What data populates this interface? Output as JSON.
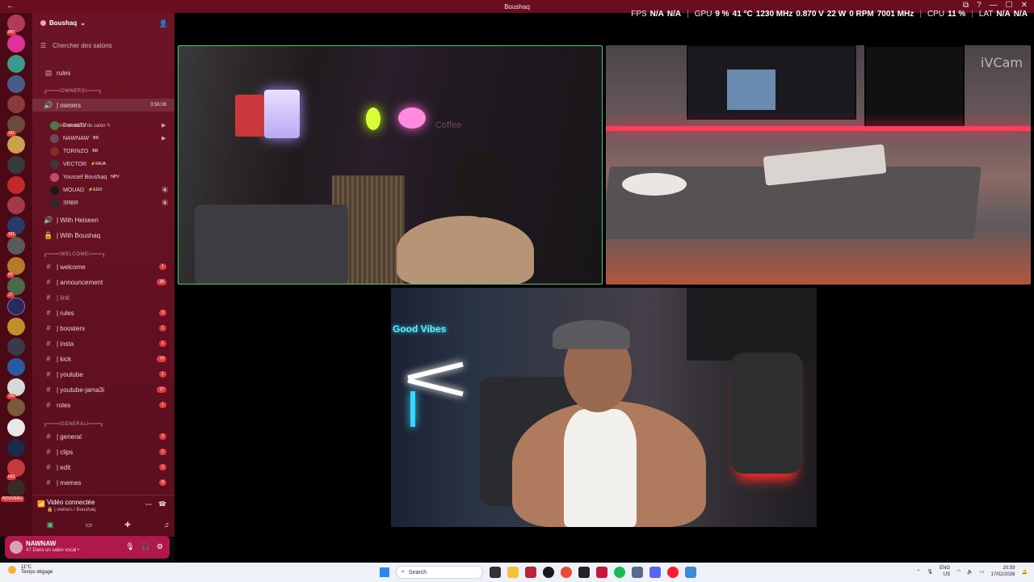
{
  "window": {
    "title": "Boushaq",
    "back": "←",
    "controls": [
      "⧉",
      "?",
      "—",
      "☐",
      "✕"
    ]
  },
  "overlay": {
    "fps_label": "FPS",
    "fps_v1": "N/A",
    "fps_v2": "N/A",
    "gpu_label": "GPU",
    "gpu_load": "9 %",
    "gpu_temp": "41 °C",
    "gpu_clock": "1230 MHz",
    "gpu_volt": "0.870 V",
    "gpu_power": "22 W",
    "gpu_fan": "0 RPM",
    "gpu_mem": "7001 MHz",
    "cpu_label": "CPU",
    "cpu_load": "11 %",
    "lat_label": "LAT",
    "lat_v1": "N/A",
    "lat_v2": "N/A"
  },
  "server_rail": {
    "badges": [
      "847",
      "",
      "",
      "",
      "",
      "",
      "341",
      "",
      "",
      "",
      "",
      "",
      "",
      "341",
      "",
      "60",
      "27",
      "",
      "",
      "",
      "",
      "",
      "190",
      "",
      "",
      "663",
      "",
      "10"
    ],
    "nouveau": "NOUVEAU"
  },
  "sidebar": {
    "server_name": "Boushaq",
    "search_placeholder": "Chercher des salons",
    "rules_top": "rules",
    "cat_owners": "╔═══/OWNERS\\═══╗",
    "owners_channel": "| owners",
    "owners_timer": "3:56:06",
    "owners_status": "Définir un statut de salon ✎",
    "users": [
      {
        "name": "DanasTV",
        "tag": ""
      },
      {
        "name": "NAWNAW",
        "tag": "BR"
      },
      {
        "name": "TORINZO",
        "tag": "BR"
      },
      {
        "name": "VECTOR",
        "tag": "⚡RAJA"
      },
      {
        "name": "Youssef Boushaq",
        "tag": "NPV"
      },
      {
        "name": "MOUAD",
        "tag": "⚡EGO"
      },
      {
        "name": "ЗЯВЯ",
        "tag": ""
      }
    ],
    "with_heiseen": "| With Heiseen",
    "with_boushaq": "| With Boushaq",
    "cat_welcome": "╔═══/WELCOME\\═══╗",
    "cat_general": "╔═══/GENERAL\\═══╗",
    "channels": [
      {
        "name": "| welcome",
        "count": "1"
      },
      {
        "name": "| announcement",
        "count": "26"
      },
      {
        "name": "| link",
        "count": ""
      },
      {
        "name": "| rules",
        "count": "3"
      },
      {
        "name": "| boosters",
        "count": "1"
      },
      {
        "name": "| insta",
        "count": "1"
      },
      {
        "name": "| kick",
        "count": "74"
      },
      {
        "name": "| youtube",
        "count": "1"
      },
      {
        "name": "| youtube-jama3i",
        "count": "17"
      },
      {
        "name": "roles",
        "count": "1"
      }
    ],
    "general_channels": [
      {
        "name": "| general",
        "count": "2"
      },
      {
        "name": "| clips",
        "count": "1"
      },
      {
        "name": "| edit",
        "count": "2"
      },
      {
        "name": "| memes",
        "count": "8"
      }
    ]
  },
  "voice": {
    "connected": "Vidéo connectée",
    "location": "🔒 | owners / Boushaq"
  },
  "user": {
    "name": "NAWNAW",
    "status": "47 Dans un salon vocal •"
  },
  "tiles": {
    "ivcam": "iVCam",
    "coffee": "Coffee",
    "goodvibes": "Good Vibes"
  },
  "taskbar": {
    "temp": "11°C",
    "weather": "Temps dégagé",
    "search": "Search",
    "lang1": "ENG",
    "lang2": "US",
    "time": "20:59",
    "date": "17/02/2026"
  }
}
